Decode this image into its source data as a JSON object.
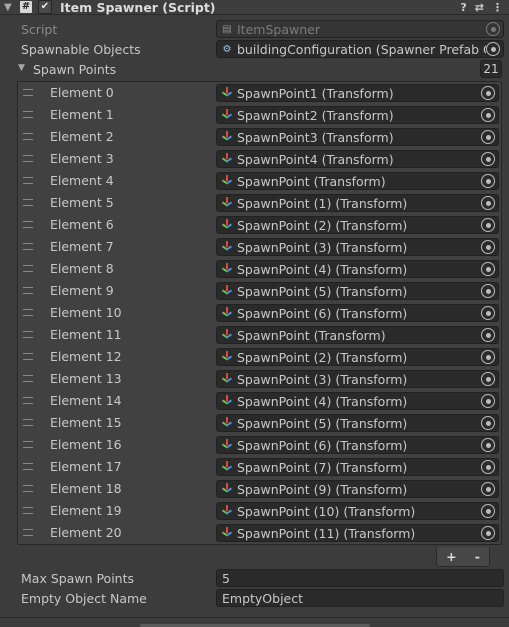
{
  "component": {
    "title": "Item Spawner (Script)",
    "enabled_check": "✔",
    "menu_icons": [
      "help-icon",
      "preset-icon",
      "more-icon"
    ]
  },
  "script": {
    "label": "Script",
    "value": "ItemSpawner"
  },
  "spawnable": {
    "label": "Spawnable Objects",
    "value": "buildingConfiguration (Spawner Prefab Confi"
  },
  "spawn_points": {
    "label": "Spawn Points",
    "count": "21",
    "elements": [
      {
        "name": "Element 0",
        "value": "SpawnPoint1 (Transform)"
      },
      {
        "name": "Element 1",
        "value": "SpawnPoint2 (Transform)"
      },
      {
        "name": "Element 2",
        "value": "SpawnPoint3 (Transform)"
      },
      {
        "name": "Element 3",
        "value": "SpawnPoint4 (Transform)"
      },
      {
        "name": "Element 4",
        "value": "SpawnPoint (Transform)"
      },
      {
        "name": "Element 5",
        "value": "SpawnPoint (1) (Transform)"
      },
      {
        "name": "Element 6",
        "value": "SpawnPoint (2) (Transform)"
      },
      {
        "name": "Element 7",
        "value": "SpawnPoint (3) (Transform)"
      },
      {
        "name": "Element 8",
        "value": "SpawnPoint (4) (Transform)"
      },
      {
        "name": "Element 9",
        "value": "SpawnPoint (5) (Transform)"
      },
      {
        "name": "Element 10",
        "value": "SpawnPoint (6) (Transform)"
      },
      {
        "name": "Element 11",
        "value": "SpawnPoint (Transform)"
      },
      {
        "name": "Element 12",
        "value": "SpawnPoint (2) (Transform)"
      },
      {
        "name": "Element 13",
        "value": "SpawnPoint (3) (Transform)"
      },
      {
        "name": "Element 14",
        "value": "SpawnPoint (4) (Transform)"
      },
      {
        "name": "Element 15",
        "value": "SpawnPoint (5) (Transform)"
      },
      {
        "name": "Element 16",
        "value": "SpawnPoint (6) (Transform)"
      },
      {
        "name": "Element 17",
        "value": "SpawnPoint (7) (Transform)"
      },
      {
        "name": "Element 18",
        "value": "SpawnPoint (9) (Transform)"
      },
      {
        "name": "Element 19",
        "value": "SpawnPoint (10) (Transform)"
      },
      {
        "name": "Element 20",
        "value": "SpawnPoint (11) (Transform)"
      }
    ],
    "add_label": "+",
    "remove_label": "-"
  },
  "max_spawn": {
    "label": "Max Spawn Points",
    "value": "5"
  },
  "empty_name": {
    "label": "Empty Object Name",
    "value": "EmptyObject"
  }
}
